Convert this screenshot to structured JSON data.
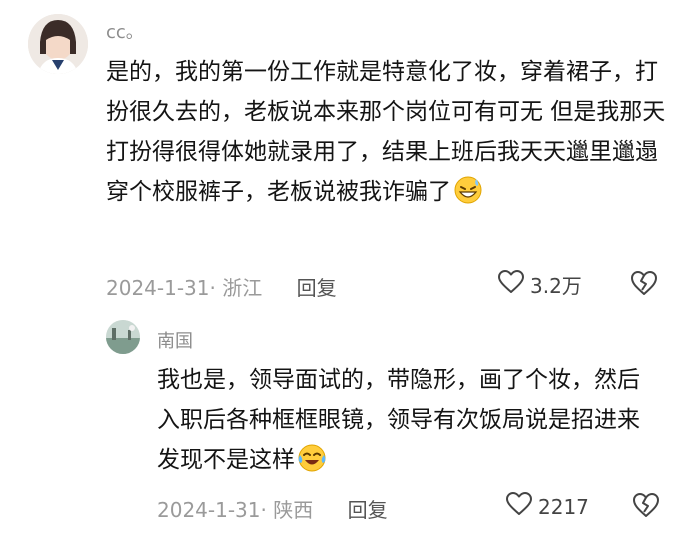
{
  "comment": {
    "username": "cc。",
    "text": "是的，我的第一份工作就是特意化了妆，穿着裙子，打扮很久去的，老板说本来那个岗位可有可无 但是我那天打扮得很得体她就录用了，结果上班后我天天邋里邋遢穿个校服裤子，老板说被我诈骗了",
    "date_location": "2024-1-31· 浙江",
    "reply_label": "回复",
    "likes": "3.2万",
    "emoji": "grinning-sweat-emoji"
  },
  "reply": {
    "username": "南国",
    "text": "我也是，领导面试的，带隐形，画了个妆，然后入职后各种框框眼镜，领导有次饭局说是招进来发现不是这样",
    "date_location": "2024-1-31· 陕西",
    "reply_label": "回复",
    "likes": "2217",
    "emoji": "crying-laughing-emoji"
  },
  "icons": {
    "like": "heart-outline-icon",
    "dislike": "broken-heart-icon"
  },
  "colors": {
    "text": "#141414",
    "meta": "#9a9a9a",
    "username": "#8d8d8d"
  }
}
